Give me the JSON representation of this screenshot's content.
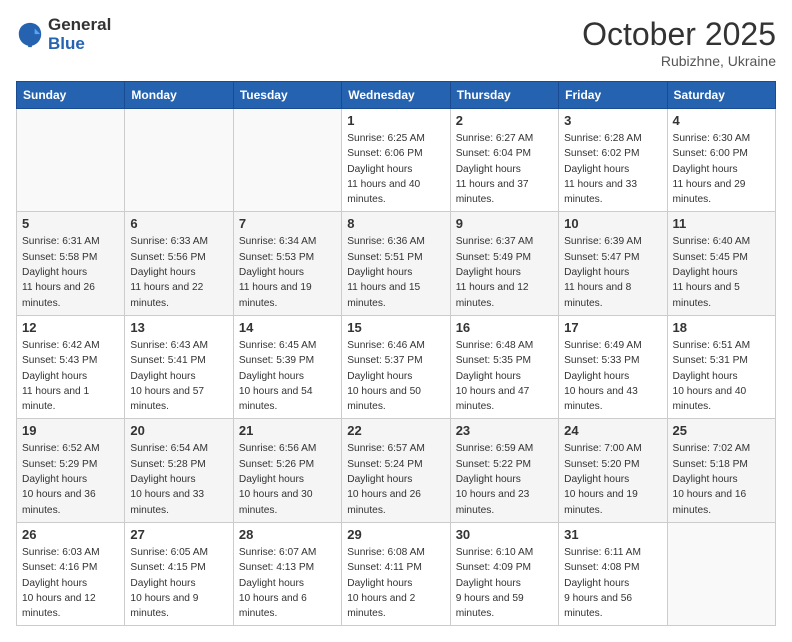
{
  "logo": {
    "general": "General",
    "blue": "Blue"
  },
  "header": {
    "month": "October 2025",
    "location": "Rubizhne, Ukraine"
  },
  "weekdays": [
    "Sunday",
    "Monday",
    "Tuesday",
    "Wednesday",
    "Thursday",
    "Friday",
    "Saturday"
  ],
  "weeks": [
    [
      {
        "day": null
      },
      {
        "day": null
      },
      {
        "day": null
      },
      {
        "day": 1,
        "sunrise": "6:25 AM",
        "sunset": "6:06 PM",
        "daylight": "11 hours and 40 minutes."
      },
      {
        "day": 2,
        "sunrise": "6:27 AM",
        "sunset": "6:04 PM",
        "daylight": "11 hours and 37 minutes."
      },
      {
        "day": 3,
        "sunrise": "6:28 AM",
        "sunset": "6:02 PM",
        "daylight": "11 hours and 33 minutes."
      },
      {
        "day": 4,
        "sunrise": "6:30 AM",
        "sunset": "6:00 PM",
        "daylight": "11 hours and 29 minutes."
      }
    ],
    [
      {
        "day": 5,
        "sunrise": "6:31 AM",
        "sunset": "5:58 PM",
        "daylight": "11 hours and 26 minutes."
      },
      {
        "day": 6,
        "sunrise": "6:33 AM",
        "sunset": "5:56 PM",
        "daylight": "11 hours and 22 minutes."
      },
      {
        "day": 7,
        "sunrise": "6:34 AM",
        "sunset": "5:53 PM",
        "daylight": "11 hours and 19 minutes."
      },
      {
        "day": 8,
        "sunrise": "6:36 AM",
        "sunset": "5:51 PM",
        "daylight": "11 hours and 15 minutes."
      },
      {
        "day": 9,
        "sunrise": "6:37 AM",
        "sunset": "5:49 PM",
        "daylight": "11 hours and 12 minutes."
      },
      {
        "day": 10,
        "sunrise": "6:39 AM",
        "sunset": "5:47 PM",
        "daylight": "11 hours and 8 minutes."
      },
      {
        "day": 11,
        "sunrise": "6:40 AM",
        "sunset": "5:45 PM",
        "daylight": "11 hours and 5 minutes."
      }
    ],
    [
      {
        "day": 12,
        "sunrise": "6:42 AM",
        "sunset": "5:43 PM",
        "daylight": "11 hours and 1 minute."
      },
      {
        "day": 13,
        "sunrise": "6:43 AM",
        "sunset": "5:41 PM",
        "daylight": "10 hours and 57 minutes."
      },
      {
        "day": 14,
        "sunrise": "6:45 AM",
        "sunset": "5:39 PM",
        "daylight": "10 hours and 54 minutes."
      },
      {
        "day": 15,
        "sunrise": "6:46 AM",
        "sunset": "5:37 PM",
        "daylight": "10 hours and 50 minutes."
      },
      {
        "day": 16,
        "sunrise": "6:48 AM",
        "sunset": "5:35 PM",
        "daylight": "10 hours and 47 minutes."
      },
      {
        "day": 17,
        "sunrise": "6:49 AM",
        "sunset": "5:33 PM",
        "daylight": "10 hours and 43 minutes."
      },
      {
        "day": 18,
        "sunrise": "6:51 AM",
        "sunset": "5:31 PM",
        "daylight": "10 hours and 40 minutes."
      }
    ],
    [
      {
        "day": 19,
        "sunrise": "6:52 AM",
        "sunset": "5:29 PM",
        "daylight": "10 hours and 36 minutes."
      },
      {
        "day": 20,
        "sunrise": "6:54 AM",
        "sunset": "5:28 PM",
        "daylight": "10 hours and 33 minutes."
      },
      {
        "day": 21,
        "sunrise": "6:56 AM",
        "sunset": "5:26 PM",
        "daylight": "10 hours and 30 minutes."
      },
      {
        "day": 22,
        "sunrise": "6:57 AM",
        "sunset": "5:24 PM",
        "daylight": "10 hours and 26 minutes."
      },
      {
        "day": 23,
        "sunrise": "6:59 AM",
        "sunset": "5:22 PM",
        "daylight": "10 hours and 23 minutes."
      },
      {
        "day": 24,
        "sunrise": "7:00 AM",
        "sunset": "5:20 PM",
        "daylight": "10 hours and 19 minutes."
      },
      {
        "day": 25,
        "sunrise": "7:02 AM",
        "sunset": "5:18 PM",
        "daylight": "10 hours and 16 minutes."
      }
    ],
    [
      {
        "day": 26,
        "sunrise": "6:03 AM",
        "sunset": "4:16 PM",
        "daylight": "10 hours and 12 minutes."
      },
      {
        "day": 27,
        "sunrise": "6:05 AM",
        "sunset": "4:15 PM",
        "daylight": "10 hours and 9 minutes."
      },
      {
        "day": 28,
        "sunrise": "6:07 AM",
        "sunset": "4:13 PM",
        "daylight": "10 hours and 6 minutes."
      },
      {
        "day": 29,
        "sunrise": "6:08 AM",
        "sunset": "4:11 PM",
        "daylight": "10 hours and 2 minutes."
      },
      {
        "day": 30,
        "sunrise": "6:10 AM",
        "sunset": "4:09 PM",
        "daylight": "9 hours and 59 minutes."
      },
      {
        "day": 31,
        "sunrise": "6:11 AM",
        "sunset": "4:08 PM",
        "daylight": "9 hours and 56 minutes."
      },
      {
        "day": null
      }
    ]
  ]
}
